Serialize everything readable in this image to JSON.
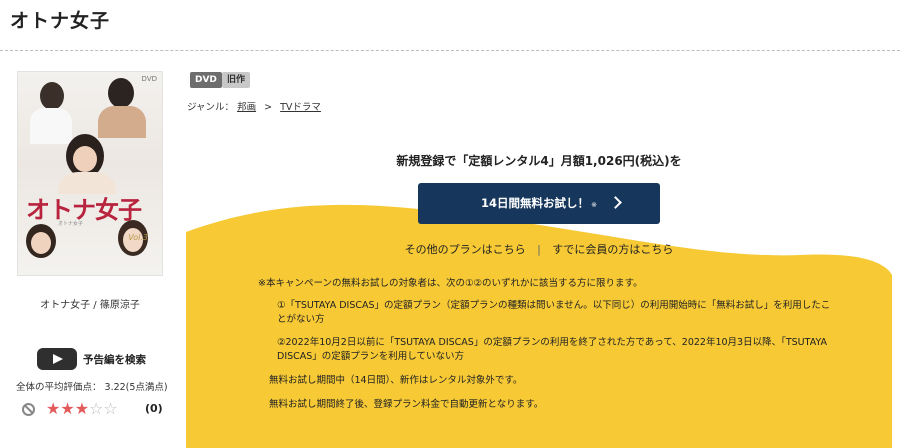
{
  "page": {
    "title": "オトナ女子"
  },
  "cover": {
    "dvd_mark": "DVD",
    "title_art": "オトナ女子",
    "vol": "Vol.3",
    "sub": "オトナ女子"
  },
  "item": {
    "cast": "オトナ女子 / 篠原涼子",
    "trailer_label": "予告編を検索",
    "rating_text": "全体の平均評価点： 3.22(5点満点)",
    "rating_value": 3.22,
    "rating_max": 5,
    "stars_filled": 3,
    "review_count": "(0)"
  },
  "badges": {
    "dvd": "DVD",
    "old": "旧作"
  },
  "genre": {
    "label": "ジャンル：",
    "link1": "邦画",
    "sep": ">",
    "link2": "TVドラマ"
  },
  "promo": {
    "headline": "新規登録で「定額レンタル4」月額1,026円(税込)を",
    "button_label": "14日間無料お試し！",
    "button_note": "※",
    "link_other_plans": "その他のプランはこちら",
    "link_divider": "|",
    "link_members": "すでに会員の方はこちら",
    "note_1": "※本キャンペーンの無料お試しの対象者は、次の①②のいずれかに該当する方に限ります。",
    "note_2": "①「TSUTAYA DISCAS」の定額プラン（定額プランの種類は問いません。以下同じ）の利用開始時に「無料お試し」を利用したことがない方",
    "note_3": "②2022年10月2日以前に「TSUTAYA DISCAS」の定額プランの利用を終了された方であって、2022年10月3日以降、「TSUTAYA DISCAS」の定額プランを利用していない方",
    "note_4": "無料お試し期間中（14日間）、新作はレンタル対象外です。",
    "note_5": "無料お試し期間終了後、登録プラン料金で自動更新となります。"
  },
  "colors": {
    "accent_yellow": "#f6c935",
    "button_navy": "#16365c",
    "star_red": "#e35a5a"
  },
  "icons": [
    "play-icon",
    "no-entry-icon",
    "star-icon",
    "chevron-right-icon"
  ]
}
